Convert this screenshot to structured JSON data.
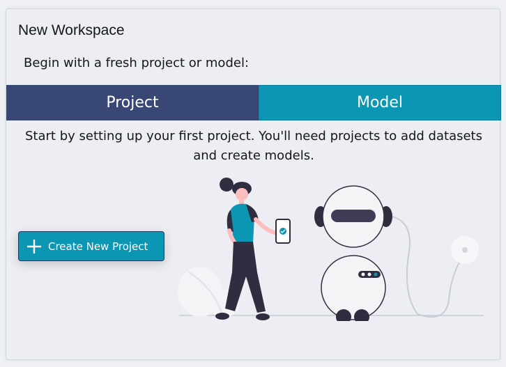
{
  "panel": {
    "title": "New Workspace",
    "subtitle": "Begin with a fresh project or model:"
  },
  "tabs": [
    {
      "label": "Project",
      "active": true
    },
    {
      "label": "Model",
      "active": false
    }
  ],
  "content": {
    "description": "Start by setting up your first project. You'll need projects to add datasets and create models.",
    "create_button_label": "Create New Project",
    "create_button_icon": "plus-icon"
  },
  "colors": {
    "project_tab": "#384773",
    "model_tab": "#0b97b3",
    "accent": "#0b97b3"
  }
}
